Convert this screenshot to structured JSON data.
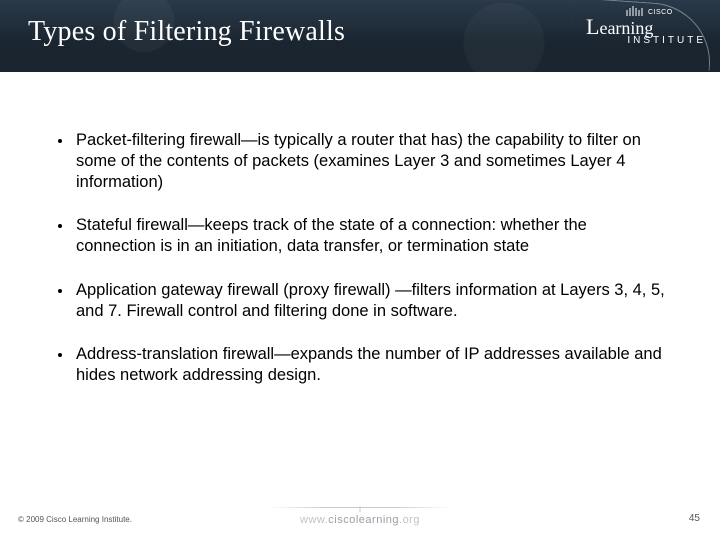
{
  "header": {
    "title": "Types of Filtering Firewalls",
    "logo": {
      "brand_small": "CISCO",
      "line1_big": "L",
      "line1_rest": "earning",
      "line2": "INSTITUTE"
    }
  },
  "bullets": [
    "Packet-filtering firewall—is typically a router that has) the capability to filter on some of the contents of packets (examines Layer 3 and sometimes Layer 4 information)",
    "Stateful firewall—keeps track of the state of a connection: whether the connection is in an initiation, data transfer, or termination state",
    "Application gateway firewall (proxy firewall) —filters information at Layers 3, 4, 5, and 7. Firewall control and filtering done in software.",
    "Address-translation firewall—expands the number of IP addresses available and hides network addressing design."
  ],
  "footer": {
    "copyright": "© 2009 Cisco Learning Institute.",
    "url_prefix": "www.",
    "url_main": "ciscolearning",
    "url_suffix": ".org",
    "slide_number": "45"
  }
}
